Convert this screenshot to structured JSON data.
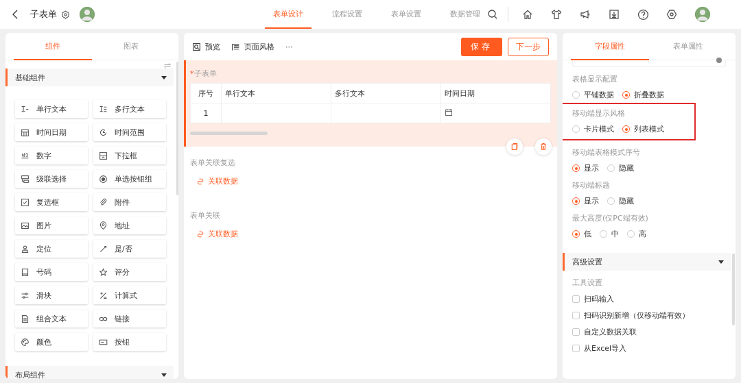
{
  "header": {
    "title": "子表单",
    "tabs": [
      {
        "label": "表单设计",
        "selected": true
      },
      {
        "label": "流程设置",
        "selected": false
      },
      {
        "label": "表单设置",
        "selected": false
      },
      {
        "label": "数据管理",
        "selected": false
      }
    ]
  },
  "left_panel": {
    "tabs": [
      {
        "label": "组件",
        "selected": true
      },
      {
        "label": "图表",
        "selected": false
      }
    ],
    "sections": [
      {
        "title": "基础组件",
        "expanded": true,
        "items": [
          "单行文本",
          "多行文本",
          "时间日期",
          "时间范围",
          "数字",
          "下拉框",
          "级联选择",
          "单选按钮组",
          "复选框",
          "附件",
          "图片",
          "地址",
          "定位",
          "是/否",
          "号码",
          "评分",
          "滑块",
          "计算式",
          "组合文本",
          "链接",
          "颜色",
          "按钮"
        ]
      },
      {
        "title": "布局组件",
        "expanded": true
      }
    ]
  },
  "canvas": {
    "toolbar": {
      "preview": "预览",
      "page_style": "页面风格",
      "more": "···",
      "save": "保存",
      "next": "下一步"
    },
    "subform": {
      "title": "子表单",
      "required_mark": "*",
      "selected": true,
      "columns": [
        "序号",
        "单行文本",
        "多行文本",
        "时间日期"
      ],
      "rows": [
        [
          "1",
          "",
          "",
          ""
        ]
      ]
    },
    "fields": [
      {
        "label": "表单关联复选",
        "link": "关联数据"
      },
      {
        "label": "表单关联",
        "link": "关联数据"
      }
    ]
  },
  "right_panel": {
    "tabs": [
      {
        "label": "字段属性",
        "selected": true
      },
      {
        "label": "表单属性",
        "selected": false
      }
    ],
    "groups": [
      {
        "label": "表格显示配置",
        "highlighted": false,
        "options": [
          {
            "label": "平铺数据",
            "selected": false
          },
          {
            "label": "折叠数据",
            "selected": true
          }
        ]
      },
      {
        "label": "移动端显示风格",
        "highlighted": true,
        "options": [
          {
            "label": "卡片模式",
            "selected": false
          },
          {
            "label": "列表模式",
            "selected": true
          }
        ]
      },
      {
        "label": "移动端表格模式序号",
        "highlighted": false,
        "options": [
          {
            "label": "显示",
            "selected": true
          },
          {
            "label": "隐藏",
            "selected": false
          }
        ]
      },
      {
        "label": "移动端标题",
        "highlighted": false,
        "options": [
          {
            "label": "显示",
            "selected": true
          },
          {
            "label": "隐藏",
            "selected": false
          }
        ]
      },
      {
        "label": "最大高度(仅PC端有效)",
        "highlighted": false,
        "options": [
          {
            "label": "低",
            "selected": true
          },
          {
            "label": "中",
            "selected": false
          },
          {
            "label": "高",
            "selected": false
          }
        ]
      }
    ],
    "advanced": {
      "title": "高级设置",
      "expanded": true,
      "subtitle": "工具设置",
      "checkboxes": [
        {
          "label": "扫码输入",
          "checked": false
        },
        {
          "label": "扫码识别新增（仅移动端有效）",
          "checked": false
        },
        {
          "label": "自定义数据关联",
          "checked": false
        },
        {
          "label": "从Excel导入",
          "checked": false
        }
      ]
    }
  }
}
